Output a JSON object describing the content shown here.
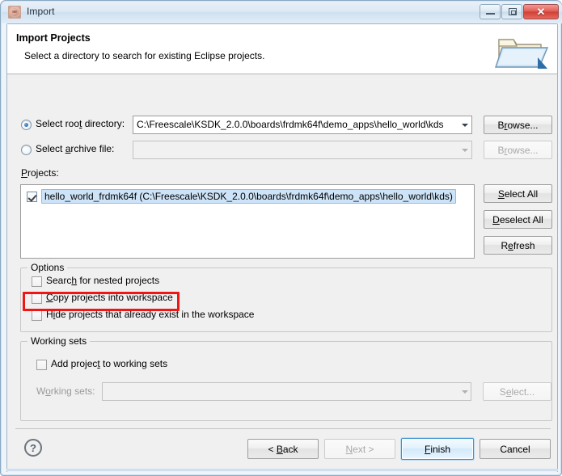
{
  "window": {
    "title": "Import",
    "icon": "eclipse-import-icon",
    "buttons": {
      "minimize": "minimize",
      "maximize": "restore",
      "close": "✕"
    }
  },
  "header": {
    "title": "Import Projects",
    "subtitle": "Select a directory to search for existing Eclipse projects.",
    "icon": "open-folder-icon"
  },
  "source": {
    "root_directory": {
      "label": "Select root directory:",
      "accel": "t",
      "selected": true,
      "value": "C:\\Freescale\\KSDK_2.0.0\\boards\\frdmk64f\\demo_apps\\hello_world\\kds",
      "browse_label": "Browse...",
      "browse_accel": "r"
    },
    "archive_file": {
      "label": "Select archive file:",
      "accel": "a",
      "selected": false,
      "value": "",
      "browse_label": "Browse...",
      "browse_accel": "r",
      "enabled": false
    }
  },
  "projects": {
    "label": "Projects:",
    "accel": "P",
    "items": [
      {
        "checked": true,
        "text": "hello_world_frdmk64f (C:\\Freescale\\KSDK_2.0.0\\boards\\frdmk64f\\demo_apps\\hello_world\\kds)",
        "selected": true
      }
    ],
    "buttons": [
      {
        "label": "Select All",
        "accel": "S",
        "enabled": true
      },
      {
        "label": "Deselect All",
        "accel": "D",
        "enabled": true
      },
      {
        "label": "Refresh",
        "accel": "e",
        "enabled": true
      }
    ]
  },
  "options": {
    "title": "Options",
    "items": [
      {
        "label": "Search for nested projects",
        "accel": "h",
        "checked": false,
        "highlighted": false
      },
      {
        "label": "Copy projects into workspace",
        "accel": "C",
        "checked": false,
        "highlighted": true
      },
      {
        "label": "Hide projects that already exist in the workspace",
        "accel": "i",
        "checked": false,
        "highlighted": false
      }
    ]
  },
  "working_sets": {
    "title": "Working sets",
    "add_checkbox": {
      "label": "Add project to working sets",
      "accel": "t",
      "checked": false
    },
    "combo_label": "Working sets:",
    "combo_accel": "o",
    "combo_value": "",
    "combo_enabled": false,
    "select_button": {
      "label": "Select...",
      "accel": "e",
      "enabled": false
    }
  },
  "footer": {
    "help": "?",
    "buttons": [
      {
        "name": "back",
        "label": "< Back",
        "accel": "B",
        "enabled": true,
        "default": false
      },
      {
        "name": "next",
        "label": "Next >",
        "accel": "N",
        "enabled": false,
        "default": false
      },
      {
        "name": "finish",
        "label": "Finish",
        "accel": "F",
        "enabled": true,
        "default": true
      },
      {
        "name": "cancel",
        "label": "Cancel",
        "accel": "",
        "enabled": true,
        "default": false
      }
    ]
  },
  "colors": {
    "accent": "#3c93d0",
    "annotation": "#ef1616",
    "selection": "#cde3f7",
    "dialog_bg": "#f0f0f0"
  }
}
